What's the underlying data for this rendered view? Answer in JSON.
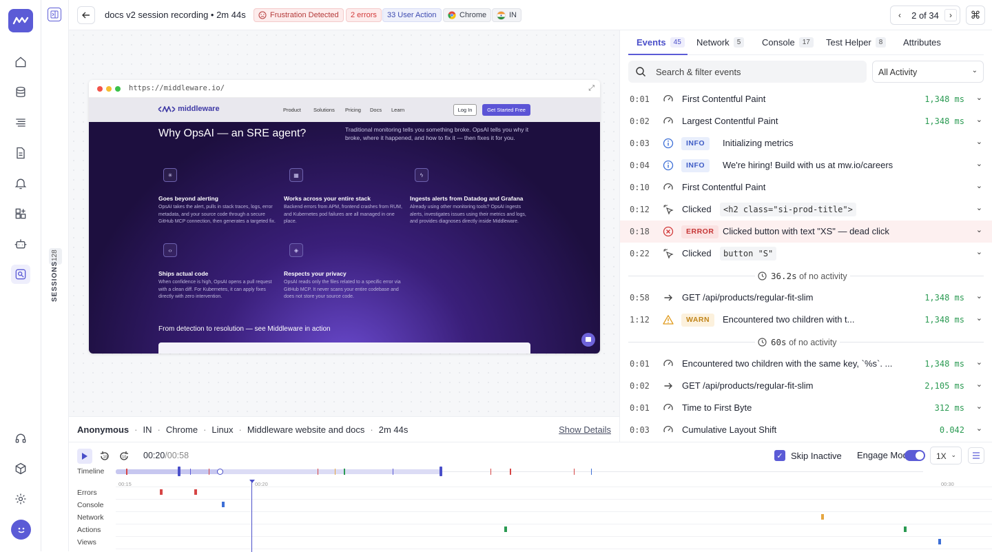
{
  "rail": {
    "icons": [
      "home-icon",
      "database-icon",
      "list-icon",
      "document-icon",
      "alert-icon",
      "dashboard-add-icon",
      "robot-icon",
      "session-replay-icon"
    ],
    "bottom_icons": [
      "headset-icon",
      "cube-add-icon",
      "settings-icon"
    ],
    "accent": "#5b5bd6"
  },
  "sessions": {
    "label": "SESSIONS",
    "count": "128"
  },
  "header": {
    "title": "docs v2 session recording • 2m 44s",
    "badges": {
      "frustration": "Frustration Detected",
      "errors": "2 errors",
      "user_action": "33 User Action",
      "browser": "Chrome",
      "country": "IN"
    },
    "pager": "2 of 34"
  },
  "browser": {
    "url": "https://middleware.io/",
    "site": {
      "logo": "middleware",
      "nav": [
        "Product",
        "Solutions",
        "Pricing",
        "Docs",
        "Learn"
      ],
      "login": "Log In",
      "cta": "Get Started Free",
      "headline": "Why OpsAI — an SRE agent?",
      "subhead": "Traditional monitoring tells you something broke. OpsAI tells you why it broke, where it happened, and how to fix it — then fixes it for you.",
      "features": [
        {
          "title": "Goes beyond alerting",
          "desc": "OpsAI takes the alert, pulls in stack traces, logs, error metadata, and your source code through a secure GitHub MCP connection, then generates a targeted fix."
        },
        {
          "title": "Works across your entire stack",
          "desc": "Backend errors from APM, frontend crashes from RUM, and Kubernetes pod failures are all managed in one place."
        },
        {
          "title": "Ingests alerts from Datadog and Grafana",
          "desc": "Already using other monitoring tools? OpsAI ingests alerts, investigates issues using their metrics and logs, and provides diagnoses directly inside Middleware."
        },
        {
          "title": "Ships actual code",
          "desc": "When confidence is high, OpsAI opens a pull request with a clean diff. For Kubernetes, it can apply fixes directly with zero intervention."
        },
        {
          "title": "Respects your privacy",
          "desc": "OpsAI reads only the files related to a specific error via GitHub MCP. It never scans your entire codebase and does not store your source code."
        }
      ],
      "bottom_heading": "From detection to resolution — see Middleware in action"
    }
  },
  "info": {
    "user": "Anonymous",
    "country": "IN",
    "browser": "Chrome",
    "os": "Linux",
    "app": "Middleware website and docs",
    "duration": "2m 44s",
    "show_details": "Show Details"
  },
  "panel": {
    "tabs": [
      {
        "label": "Events",
        "count": "45"
      },
      {
        "label": "Network",
        "count": "5"
      },
      {
        "label": "Console",
        "count": "17"
      },
      {
        "label": "Test Helper",
        "count": "8"
      },
      {
        "label": "Attributes",
        "count": ""
      }
    ],
    "search_placeholder": "Search & filter events",
    "activity_filter": "All Activity",
    "events": [
      {
        "time": "0:01",
        "icon": "gauge-icon",
        "text": "First Contentful Paint",
        "ms": "1,348 ms"
      },
      {
        "time": "0:02",
        "icon": "gauge-icon",
        "text": "Largest Contentful Paint",
        "ms": "1,348 ms"
      },
      {
        "time": "0:03",
        "icon": "info-icon",
        "tag": "INFO",
        "text": "Initializing metrics"
      },
      {
        "time": "0:04",
        "icon": "info-icon",
        "tag": "INFO",
        "text": "We're hiring! Build with us at mw.io/careers"
      },
      {
        "time": "0:10",
        "icon": "gauge-icon",
        "text": "First Contentful Paint"
      },
      {
        "time": "0:12",
        "icon": "click-icon",
        "text": "Clicked",
        "code": "<h2 class=\"si-prod-title\">"
      },
      {
        "time": "0:18",
        "icon": "error-icon",
        "tag": "ERROR",
        "text": "Clicked button with text \"XS\" — dead click"
      },
      {
        "time": "0:22",
        "icon": "click-icon",
        "text": "Clicked",
        "code": "button \"S\""
      }
    ],
    "idle1": {
      "value": "36.2s",
      "suffix": "of no activity"
    },
    "events2": [
      {
        "time": "0:58",
        "icon": "arrow-icon",
        "text": "GET /api/products/regular-fit-slim",
        "ms": "1,348 ms"
      },
      {
        "time": "1:12",
        "icon": "warning-icon",
        "tag": "WARN",
        "text": "Encountered two children with t...",
        "ms": "1,348 ms"
      }
    ],
    "idle2": {
      "value": "60s",
      "suffix": "of no activity"
    },
    "events3": [
      {
        "time": "0:01",
        "icon": "gauge-icon",
        "text": "Encountered two children with the same key, `%s`. ...",
        "ms": "1,348 ms"
      },
      {
        "time": "0:02",
        "icon": "arrow-icon",
        "text": "GET /api/products/regular-fit-slim",
        "ms": "2,105 ms"
      },
      {
        "time": "0:01",
        "icon": "gauge-icon",
        "text": "Time to First Byte",
        "ms": "312 ms"
      },
      {
        "time": "0:03",
        "icon": "gauge-icon",
        "text": "Cumulative Layout Shift",
        "ms": "0.042"
      }
    ]
  },
  "controls": {
    "time_current": "00:20",
    "time_total": "/00:58",
    "skip_inactive": "Skip Inactive",
    "skip_inactive_checked": true,
    "engage_mode": "Engage Mode",
    "engage_on": true,
    "speed": "1X",
    "progress": 0.34
  },
  "timeline": {
    "label": "Timeline",
    "ticks": [
      "00:15",
      "00:20",
      "00:30"
    ],
    "lanes": [
      "Errors",
      "Console",
      "Network",
      "Actions",
      "Views"
    ]
  }
}
